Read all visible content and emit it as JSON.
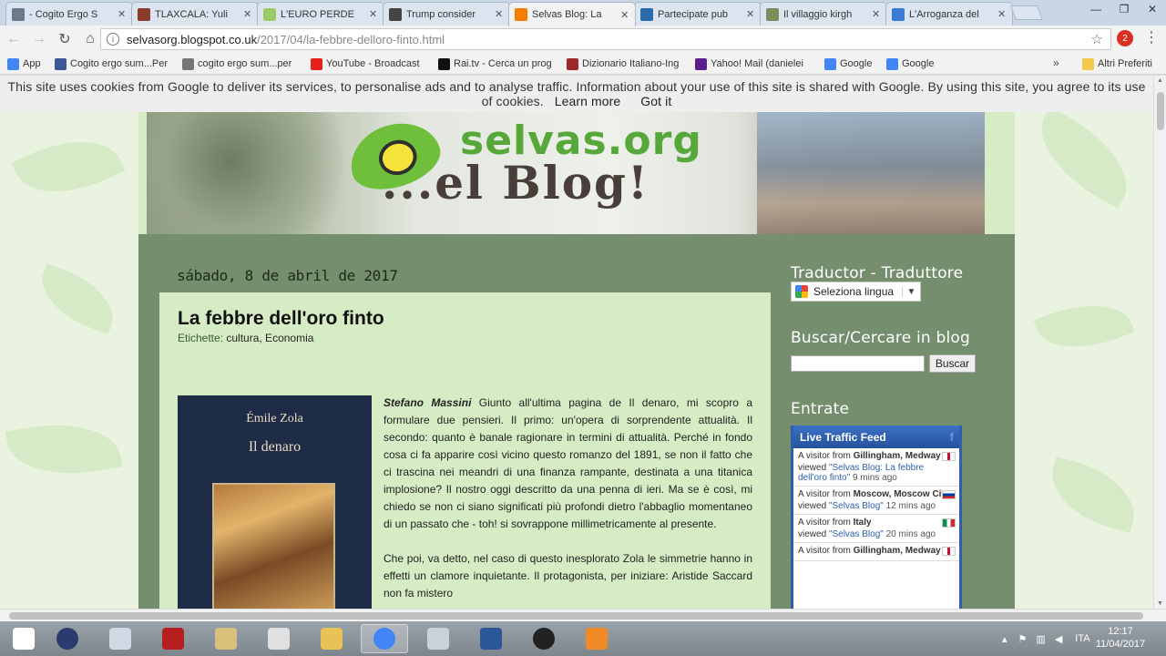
{
  "browser": {
    "tabs": [
      {
        "label": "- Cogito Ergo S",
        "icon": "gear-icon",
        "color": "#6d7a8a",
        "active": false
      },
      {
        "label": "TLAXCALA: Yuli",
        "icon": "t-icon",
        "color": "#8a3b2a",
        "active": false
      },
      {
        "label": "L'EURO PERDE",
        "icon": "s-icon",
        "color": "#9ccc65",
        "active": false
      },
      {
        "label": "Trump consider",
        "icon": "globe-icon",
        "color": "#444444",
        "active": false
      },
      {
        "label": "Selvas Blog: La",
        "icon": "blogger-icon",
        "color": "#f57d00",
        "active": true
      },
      {
        "label": "Partecipate pub",
        "icon": "ph-icon",
        "color": "#2b6cb0",
        "active": false
      },
      {
        "label": "Il villaggio kirgh",
        "icon": "image-icon",
        "color": "#7a8c5a",
        "active": false
      },
      {
        "label": "L'Arroganza del",
        "icon": "c-icon",
        "color": "#3a7bd5",
        "active": false
      }
    ],
    "tab_close": "✕",
    "url_host": "selvasorg.blogspot.co.uk",
    "url_path": "/2017/04/la-febbre-delloro-finto.html",
    "extension_badge": "2",
    "bookmarks": [
      {
        "label": "App",
        "icon": "apps-grid-icon",
        "color": "#4285f4"
      },
      {
        "label": "Cogito ergo sum...Per",
        "icon": "facebook-icon",
        "color": "#3b5998"
      },
      {
        "label": "cogito ergo sum...per",
        "icon": "image-icon",
        "color": "#777777"
      },
      {
        "label": "YouTube - Broadcast",
        "icon": "youtube-icon",
        "color": "#e62117"
      },
      {
        "label": "Rai.tv - Cerca un prog",
        "icon": "rai-icon",
        "color": "#111111"
      },
      {
        "label": "Dizionario Italiano-Ing",
        "icon": "wr-icon",
        "color": "#9c2a2a"
      },
      {
        "label": "Yahoo! Mail (danielei",
        "icon": "mail-icon",
        "color": "#5c1e8a"
      },
      {
        "label": "Google",
        "icon": "google-icon",
        "color": "#4285f4"
      },
      {
        "label": "Google",
        "icon": "google-icon",
        "color": "#4285f4"
      }
    ],
    "bookmarks_more": "»",
    "other_bookmarks": "Altri Preferiti"
  },
  "cookie_bar": {
    "text": "This site uses cookies from Google to deliver its services, to personalise ads and to analyse traffic. Information about your use of this site is shared with Google. By using this site, you agree to its use of cookies.",
    "learn_more": "Learn more",
    "got_it": "Got it"
  },
  "banner": {
    "brand_top": "selvas.org",
    "brand_bottom": "...el Blog!"
  },
  "post": {
    "date": "sábado, 8 de abril de 2017",
    "title": "La febbre dell'oro finto",
    "labels_prefix": "Etichette:",
    "labels": "cultura, Economia",
    "book_author": "Émile Zola",
    "book_title": "Il denaro",
    "byline": "Stefano Massini",
    "para1": " Giunto all'ultima pagina de Il denaro, mi scopro a formulare due pensieri. Il primo: un'opera di sorprendente attualità. Il secondo: quanto è banale ragionare in termini di attualità. Perché in fondo cosa ci fa apparire così vicino questo romanzo del 1891, se non il fatto che ci trascina nei meandri di una finanza rampante, destinata a una titanica implosione? Il nostro oggi descritto da una penna di ieri. Ma se è così, mi chiedo se non ci siano significati più profondi dietro l'abbaglio momentaneo di un passato che - toh! si sovrappone millimetricamente al presente.",
    "para2": "Che poi, va detto, nel caso di questo inesplorato Zola le simmetrie hanno in effetti un clamore inquietante. Il protagonista, per iniziare: Aristide Saccard non fa mistero"
  },
  "sidebar": {
    "translator_title": "Traductor - Traduttore",
    "translator_select": "Seleziona lingua",
    "search_title": "Buscar/Cercare in blog",
    "search_button": "Buscar",
    "entries_title": "Entrate",
    "feed_title": "Live Traffic Feed",
    "feed": [
      {
        "prefix": "A visitor from",
        "location": "Gillingham, Medway",
        "viewed": "viewed",
        "page": "\"Selvas Blog: La febbre dell'oro finto\"",
        "ago": "9 mins ago",
        "flag": "uk"
      },
      {
        "prefix": "A visitor from",
        "location": "Moscow, Moscow City",
        "viewed": "viewed",
        "page": "\"Selvas Blog\"",
        "ago": "12 mins ago",
        "flag": "ru"
      },
      {
        "prefix": "A visitor from",
        "location": "Italy",
        "viewed": "viewed",
        "page": "\"Selvas Blog\"",
        "ago": "20 mins ago",
        "flag": "it"
      },
      {
        "prefix": "A visitor from",
        "location": "Gillingham, Medway",
        "viewed": "",
        "page": "",
        "ago": "",
        "flag": "uk"
      }
    ]
  },
  "taskbar": {
    "apps": [
      "windows-start-icon",
      "globe-icon",
      "calculator-icon",
      "filezilla-icon",
      "notepad-icon",
      "paint-icon",
      "explorer-folder-icon",
      "chrome-icon",
      "document-icon",
      "word-icon",
      "obs-icon",
      "media-player-icon"
    ],
    "language": "ITA",
    "time": "12:17",
    "date": "11/04/2017"
  }
}
